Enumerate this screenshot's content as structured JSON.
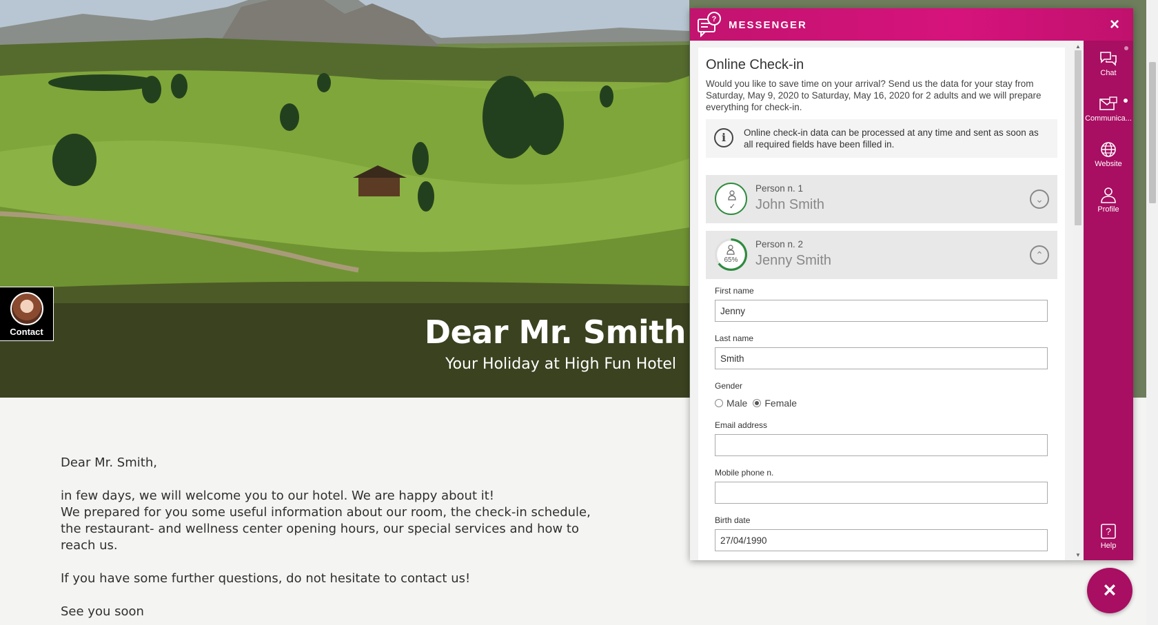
{
  "hero": {
    "title": "Dear Mr. Smith",
    "subtitle": "Your Holiday at High Fun Hotel"
  },
  "contact_widget": {
    "label": "Contact"
  },
  "letter": {
    "salutation": "Dear Mr. Smith,",
    "paragraph1_line1": "in few days, we will welcome you to our hotel. We are happy about it!",
    "paragraph1_line2": "We prepared for you some useful information about our room, the check-in schedule, the restaurant- and wellness center opening hours, our special services and how to reach us.",
    "paragraph2": "If you have some further questions, do not hesitate to contact us!",
    "closing": "See you soon"
  },
  "messenger": {
    "title": "MESSENGER",
    "close_icon": "×",
    "checkin": {
      "title": "Online Check-in",
      "description": "Would you like to save time on your arrival? Send us the data for your stay from Saturday, May 9, 2020 to Saturday, May 16, 2020 for 2 adults and we will prepare everything for check-in.",
      "info_icon": "i",
      "info_text": "Online check-in data can be processed at any time and sent as soon as all required fields have been filled in."
    },
    "persons": [
      {
        "number_label": "Person n. 1",
        "name": "John Smith",
        "status_mark": "✓",
        "toggle": "⌄"
      },
      {
        "number_label": "Person n. 2",
        "name": "Jenny Smith",
        "progress_label": "65%",
        "progress": 0.65,
        "toggle": "⌃"
      }
    ],
    "form": {
      "first_name_label": "First name",
      "first_name_value": "Jenny",
      "last_name_label": "Last name",
      "last_name_value": "Smith",
      "gender_label": "Gender",
      "gender_options": [
        "Male",
        "Female"
      ],
      "gender_selected": "Female",
      "email_label": "Email address",
      "email_value": "",
      "mobile_label": "Mobile phone n.",
      "mobile_value": "",
      "birth_date_label": "Birth date",
      "birth_date_value": "27/04/1990"
    },
    "rail": {
      "chat_label": "Chat",
      "communications_label": "Communica...",
      "website_label": "Website",
      "profile_label": "Profile",
      "help_label": "Help"
    }
  },
  "fab": {
    "icon": "×"
  },
  "colors": {
    "brand": "#c2136f",
    "rail": "#a80e62",
    "progress_green": "#2e8b3e"
  },
  "icons": [
    "messenger-logo-icon",
    "close-icon",
    "info-icon",
    "person-icon",
    "chevron-down-icon",
    "chevron-up-icon",
    "chat-icon",
    "communications-icon",
    "globe-icon",
    "profile-icon",
    "help-icon"
  ]
}
